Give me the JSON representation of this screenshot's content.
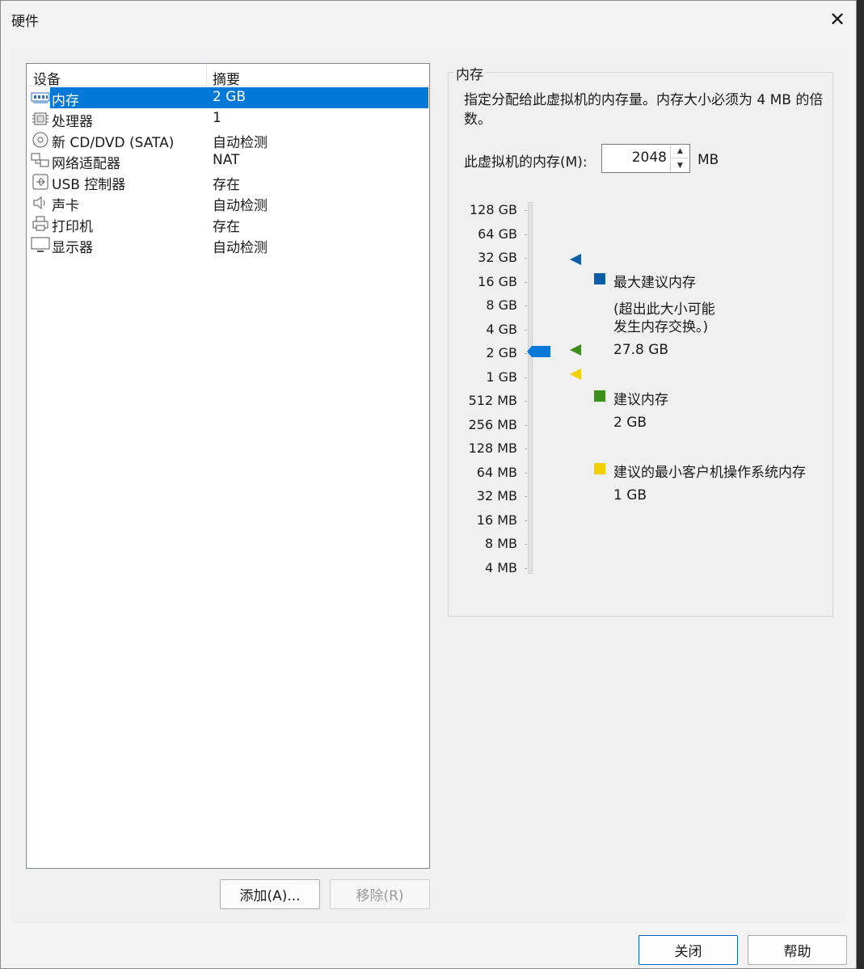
{
  "window": {
    "title": "硬件"
  },
  "devices": {
    "columns": [
      "设备",
      "摘要"
    ],
    "rows": [
      {
        "name": "内存",
        "summary": "2 GB",
        "icon": "memory-icon",
        "selected": true
      },
      {
        "name": "处理器",
        "summary": "1",
        "icon": "cpu-icon"
      },
      {
        "name": "新 CD/DVD (SATA)",
        "summary": "自动检测",
        "icon": "cd-dvd-icon"
      },
      {
        "name": "网络适配器",
        "summary": "NAT",
        "icon": "network-icon"
      },
      {
        "name": "USB 控制器",
        "summary": "存在",
        "icon": "usb-icon"
      },
      {
        "name": "声卡",
        "summary": "自动检测",
        "icon": "speaker-icon"
      },
      {
        "name": "打印机",
        "summary": "存在",
        "icon": "printer-icon"
      },
      {
        "name": "显示器",
        "summary": "自动检测",
        "icon": "monitor-icon"
      }
    ]
  },
  "buttons": {
    "add": "添加(A)...",
    "remove": "移除(R)",
    "close": "关闭",
    "help": "帮助"
  },
  "memory": {
    "group_title": "内存",
    "description": "指定分配给此虚拟机的内存量。内存大小必须为 4 MB 的倍数。",
    "field_label": "此虚拟机的内存(M):",
    "value": "2048",
    "unit": "MB",
    "scale": [
      "128 GB",
      "64 GB",
      "32 GB",
      "16 GB",
      "8 GB",
      "4 GB",
      "2 GB",
      "1 GB",
      "512 MB",
      "256 MB",
      "128 MB",
      "64 MB",
      "32 MB",
      "16 MB",
      "8 MB",
      "4 MB"
    ],
    "selected_scale": "2 GB",
    "legend": {
      "max": {
        "label": "最大建议内存",
        "note_line1": "(超出此大小可能",
        "note_line2": "发生内存交换。)",
        "value": "27.8 GB",
        "color": "#0a5ea8",
        "scale_at": "32 GB"
      },
      "recommended": {
        "label": "建议内存",
        "value": "2 GB",
        "color": "#3b8f1a",
        "scale_at": "2 GB"
      },
      "min": {
        "label": "建议的最小客户机操作系统内存",
        "value": "1 GB",
        "color": "#f2cf00",
        "scale_at": "1 GB"
      }
    }
  },
  "colors": {
    "selection": "#0078d7",
    "slider_thumb": "#0a78d6"
  }
}
